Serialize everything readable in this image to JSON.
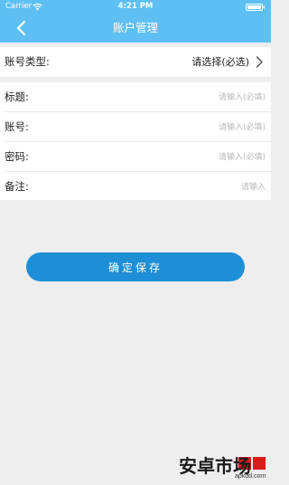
{
  "status_bar": {
    "carrier": "Carrier",
    "time": "4:21 PM",
    "icons": [
      "wifi-icon",
      "battery-icon"
    ]
  },
  "nav": {
    "back_icon": "chevron-left-icon",
    "title": "账户管理"
  },
  "account_type": {
    "label": "账号类型:",
    "value": "请选择(必选)",
    "icon": "chevron-right-icon"
  },
  "form": {
    "fields": [
      {
        "label": "标题:",
        "placeholder": "请输入(必填)",
        "value": ""
      },
      {
        "label": "账号:",
        "placeholder": "请输入(必填)",
        "value": ""
      },
      {
        "label": "密码:",
        "placeholder": "请输入(必填)",
        "value": ""
      },
      {
        "label": "备注:",
        "placeholder": "请输入",
        "value": ""
      }
    ]
  },
  "save_label": "确定保存",
  "watermark": {
    "text": "安卓市场",
    "domain": "apkdd.com"
  },
  "colors": {
    "header": "#5ec0f2",
    "button": "#1e8ed6",
    "background": "#eeeeee",
    "watermark_red": "#d81b1b"
  }
}
